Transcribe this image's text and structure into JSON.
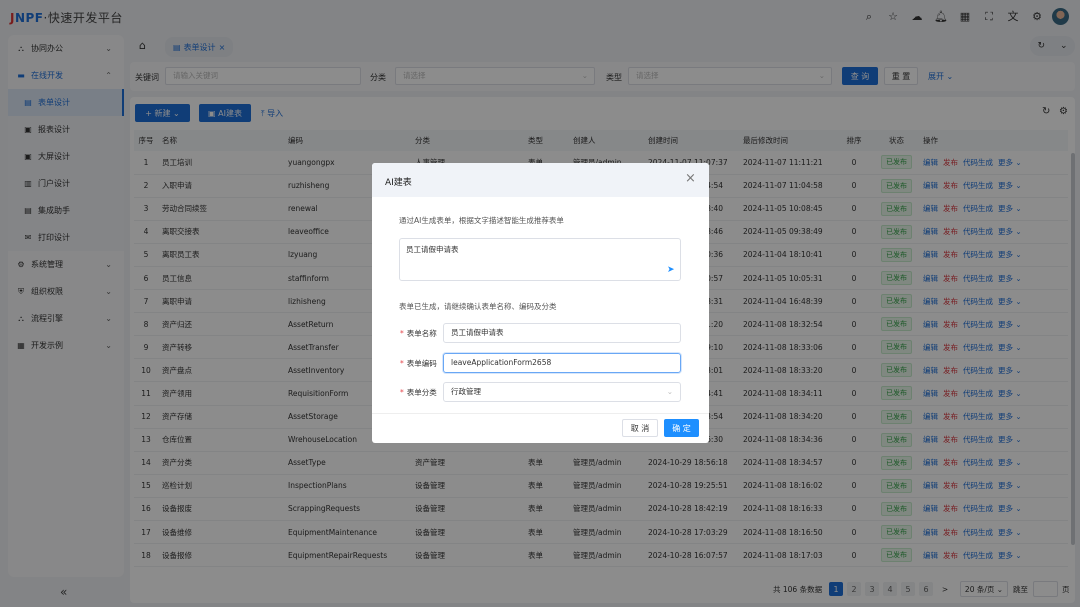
{
  "header": {
    "logo_j": "J",
    "logo_npf": "NPF",
    "logo_text": "·快速开发平台",
    "icons": [
      "search-icon",
      "star-icon",
      "message-icon",
      "bell-icon",
      "apps-icon",
      "fullscreen-icon",
      "translate-icon",
      "gear-icon"
    ]
  },
  "sidebar": {
    "items": [
      {
        "label": "协同办公",
        "icon": "users-icon",
        "type": "group",
        "state": "collapsed"
      },
      {
        "label": "在线开发",
        "icon": "dev-icon",
        "type": "group",
        "state": "open"
      },
      {
        "label": "表单设计",
        "icon": "form-icon",
        "type": "sub",
        "state": "active"
      },
      {
        "label": "报表设计",
        "icon": "report-icon",
        "type": "sub"
      },
      {
        "label": "大屏设计",
        "icon": "screen-icon",
        "type": "sub"
      },
      {
        "label": "门户设计",
        "icon": "portal-icon",
        "type": "sub"
      },
      {
        "label": "集成助手",
        "icon": "integration-icon",
        "type": "sub"
      },
      {
        "label": "打印设计",
        "icon": "print-icon",
        "type": "sub"
      },
      {
        "label": "系统管理",
        "icon": "gear-icon",
        "type": "group",
        "state": "collapsed"
      },
      {
        "label": "组织权限",
        "icon": "shield-icon",
        "type": "group",
        "state": "collapsed"
      },
      {
        "label": "流程引擎",
        "icon": "flow-icon",
        "type": "group",
        "state": "collapsed"
      },
      {
        "label": "开发示例",
        "icon": "grid-icon",
        "type": "group",
        "state": "collapsed"
      }
    ],
    "collapse": "«"
  },
  "tabs": {
    "active": "表单设计"
  },
  "filter": {
    "keyword_label": "关键词",
    "keyword_placeholder": "请输入关键词",
    "category_label": "分类",
    "category_placeholder": "请选择",
    "type_label": "类型",
    "type_placeholder": "请选择",
    "query": "查 询",
    "reset": "重 置",
    "expand": "展开"
  },
  "toolbar": {
    "new": "+ 新建",
    "ai": "AI建表",
    "import": "导入"
  },
  "table": {
    "columns": [
      "序号",
      "名称",
      "编码",
      "分类",
      "类型",
      "创建人",
      "创建时间",
      "最后修改时间",
      "排序",
      "状态",
      "操作"
    ],
    "actions": {
      "edit": "编辑",
      "publish": "发布",
      "codegen": "代码生成",
      "more": "更多"
    },
    "rows": [
      [
        "1",
        "员工培训",
        "yuangongpx",
        "人事管理",
        "表单",
        "管理员/admin",
        "2024-11-07 11:07:37",
        "2024-11-07 11:11:21",
        "0",
        "已发布"
      ],
      [
        "2",
        "入职申请",
        "ruzhisheng",
        "",
        "",
        "",
        "…4:54",
        "2024-11-07 11:04:58",
        "0",
        "已发布"
      ],
      [
        "3",
        "劳动合同续签",
        "renewal",
        "",
        "",
        "",
        "…8:40",
        "2024-11-05 10:08:45",
        "0",
        "已发布"
      ],
      [
        "4",
        "离职交接表",
        "leaveoffice",
        "",
        "",
        "",
        "…8:46",
        "2024-11-05 09:38:49",
        "0",
        "已发布"
      ],
      [
        "5",
        "离职员工表",
        "lzyuang",
        "",
        "",
        "",
        "…0:36",
        "2024-11-04 18:10:41",
        "0",
        "已发布"
      ],
      [
        "6",
        "员工信息",
        "staffinform",
        "",
        "",
        "",
        "…0:57",
        "2024-11-05 10:05:31",
        "0",
        "已发布"
      ],
      [
        "7",
        "离职申请",
        "lizhisheng",
        "",
        "",
        "",
        "…8:31",
        "2024-11-04 16:48:39",
        "0",
        "已发布"
      ],
      [
        "8",
        "资产归还",
        "AssetReturn",
        "",
        "",
        "",
        "…1:20",
        "2024-11-08 18:32:54",
        "0",
        "已发布"
      ],
      [
        "9",
        "资产转移",
        "AssetTransfer",
        "",
        "",
        "",
        "…9:10",
        "2024-11-08 18:33:06",
        "0",
        "已发布"
      ],
      [
        "10",
        "资产盘点",
        "AssetInventory",
        "",
        "",
        "",
        "…3:01",
        "2024-11-08 18:33:20",
        "0",
        "已发布"
      ],
      [
        "11",
        "资产领用",
        "RequisitionForm",
        "",
        "",
        "",
        "…4:41",
        "2024-11-08 18:34:11",
        "0",
        "已发布"
      ],
      [
        "12",
        "资产存储",
        "AssetStorage",
        "",
        "",
        "",
        "…3:54",
        "2024-11-08 18:34:20",
        "0",
        "已发布"
      ],
      [
        "13",
        "仓库位置",
        "WrehouseLocation",
        "",
        "",
        "",
        "…6:30",
        "2024-11-08 18:34:36",
        "0",
        "已发布"
      ],
      [
        "14",
        "资产分类",
        "AssetType",
        "资产管理",
        "表单",
        "管理员/admin",
        "2024-10-29 18:56:18",
        "2024-11-08 18:34:57",
        "0",
        "已发布"
      ],
      [
        "15",
        "巡检计划",
        "InspectionPlans",
        "设备管理",
        "表单",
        "管理员/admin",
        "2024-10-28 19:25:51",
        "2024-11-08 18:16:02",
        "0",
        "已发布"
      ],
      [
        "16",
        "设备报废",
        "ScrappingRequests",
        "设备管理",
        "表单",
        "管理员/admin",
        "2024-10-28 18:42:19",
        "2024-11-08 18:16:33",
        "0",
        "已发布"
      ],
      [
        "17",
        "设备维修",
        "EquipmentMaintenance",
        "设备管理",
        "表单",
        "管理员/admin",
        "2024-10-28 17:03:29",
        "2024-11-08 18:16:50",
        "0",
        "已发布"
      ],
      [
        "18",
        "设备报修",
        "EquipmentRepairRequests",
        "设备管理",
        "表单",
        "管理员/admin",
        "2024-10-28 16:07:57",
        "2024-11-08 18:17:03",
        "0",
        "已发布"
      ]
    ]
  },
  "pagination": {
    "total": "共 106 条数据",
    "pages": [
      "1",
      "2",
      "3",
      "4",
      "5",
      "6"
    ],
    "current": "1",
    "next": ">",
    "page_size": "20 条/页",
    "jump": "跳至",
    "page_unit": "页"
  },
  "modal": {
    "title": "AI建表",
    "description": "通过AI生成表单，根据文字描述智能生成推荐表单",
    "prompt": "员工请假申请表",
    "note": "表单已生成，请继续确认表单名称、编码及分类",
    "fields": [
      {
        "label": "表单名称",
        "value": "员工请假申请表"
      },
      {
        "label": "表单编码",
        "value": "leaveApplicationForm2658"
      },
      {
        "label": "表单分类",
        "value": "行政管理"
      }
    ],
    "cancel": "取 消",
    "confirm": "确 定"
  },
  "colors": {
    "primary": "#1e6fd9",
    "danger": "#d9363e",
    "success": "#35a34a"
  }
}
